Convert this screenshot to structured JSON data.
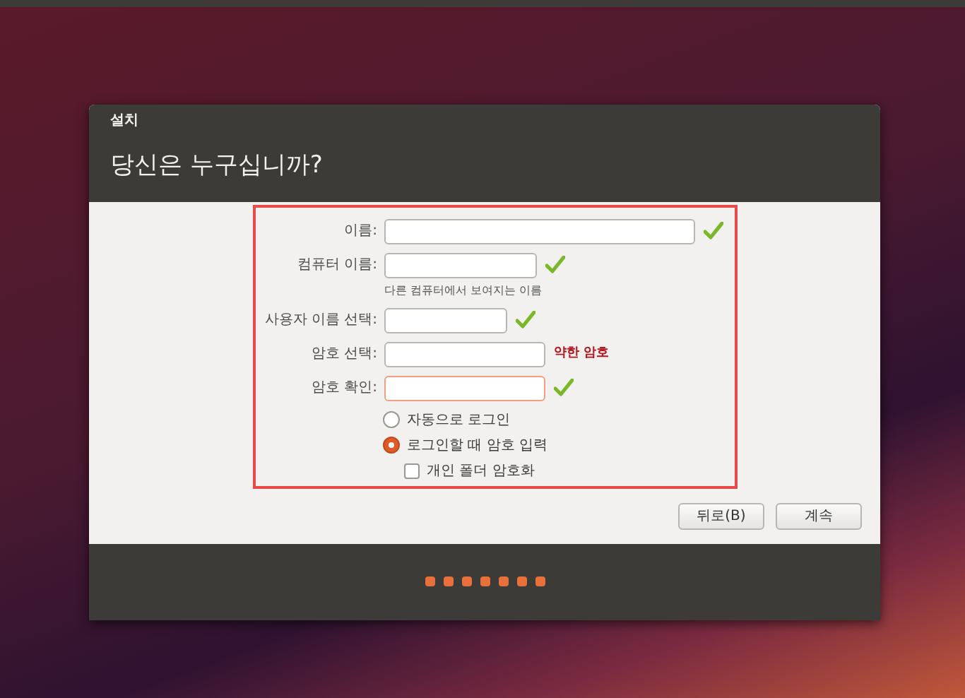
{
  "window": {
    "title": "설치"
  },
  "heading": "당신은 누구십니까?",
  "fields": [
    {
      "label": "이름:",
      "valid": true,
      "focused": false
    },
    {
      "label": "컴퓨터 이름:",
      "valid": true,
      "focused": false,
      "hint": "다른 컴퓨터에서 보여지는 이름"
    },
    {
      "label": "사용자 이름 선택:",
      "valid": true,
      "focused": false
    },
    {
      "label": "암호 선택:",
      "valid": false,
      "focused": false,
      "strength": "약한 암호"
    },
    {
      "label": "암호 확인:",
      "valid": true,
      "focused": true
    }
  ],
  "options": [
    {
      "kind": "radio",
      "label": "자동으로 로그인",
      "selected": false
    },
    {
      "kind": "radio",
      "label": "로그인할 때 암호 입력",
      "selected": true
    },
    {
      "kind": "checkbox",
      "label": "개인 폴더 암호화",
      "checked": false
    }
  ],
  "buttons": [
    "뒤로(B)",
    "계속"
  ]
}
